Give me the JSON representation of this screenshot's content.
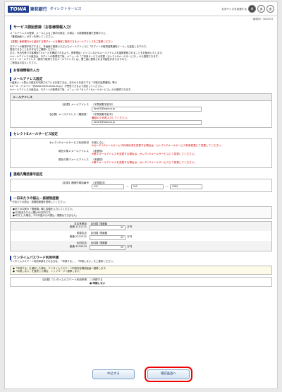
{
  "header": {
    "logo": "TOWA",
    "bank": "東和銀行",
    "service": "ダイレクトサービス",
    "font_size_label": "文字サイズを変更する",
    "font_sizes": [
      "標",
      "あ",
      "あ"
    ]
  },
  "screen_id": "画面ID：BL0003",
  "page_title": "サービス開始登録（お客様情報入力）",
  "intro": [
    "メールアドレスの登録、メールによるご案内の設定、お振込・お振替限度額を登録のうえ、",
    "「確認画面へ」ボタンを押してください。"
  ],
  "notice_red": "【重要】東和銀行から送信する電子メールを確実に受信できるメールアドレスをご登録ください",
  "notes": [
    "ログインの取得が完了すると、本画面で登録いただいたメールアドレスに「ログインの取得結果通知メール」を送信しますので、",
    "受信できることをお手元でご確認ください。",
    "また、外出先等でお客様宛てEメールを確認できるよう、携帯電話・パソコンなどのメールアドレスを複数登録されることをお勧めいたします。",
    "※メールアドレスの追加は、ログインの取得完了後、メニューの「ご利用サービスの変更（セレクトEメールサービス）」から登録できます。",
    "※フリーメールアドレス（無料で取得できるメールアドレス）は、第三者に悪用される可能性がありますので、",
    "ご使用はお控えください。"
  ],
  "customer_info_title": "お客様情報の入力",
  "email_section": {
    "title": "メールアドレス設定",
    "notes": [
      "※迷惑メール防止の設定を利用されているお客さまは、当行からお送りする「お取引結果通知」等の",
      "Eメール（ドメイン「@webcenter.anser.or.jp」）が受信できるよう設定してください。",
      "※メールアドレスの追加は、ログインの取得完了後、メニューの「セレクトEメールサービス」から登録できます。"
    ],
    "box_title": "メールアドレス",
    "email_label": "メールアドレス",
    "required": "【必須】",
    "email_hint": "（半角英数字記号）",
    "email_value": "taro01@towa.co.jp",
    "confirm_label": "メールアドレス（確認用）",
    "confirm_hint": "（半角英数字記号）",
    "confirm_note": "確認のため再入力してください。",
    "confirm_value": "taro01@towa.co.jp"
  },
  "select_section": {
    "title": "セレクトEメールサービス設定",
    "rows": [
      {
        "label": "セレクトEメールサービス利用状況",
        "value": "利用しない",
        "note": "※セレクトEメールサービス利用状況を変更する場合は、セレクトEメールサービス利用変更にて変更してください。"
      },
      {
        "label": "現在の第２メールアドレス",
        "value": "（未登録）",
        "note": "※第２メールアドレスを変更する場合は、セレクトEメールサービスにて変更してください。"
      },
      {
        "label": "現在の第３メールアドレス",
        "value": "（未登録）",
        "note": "※第３メールアドレスを変更する場合は、セレクトEメールサービスにて変更してください。"
      }
    ]
  },
  "phone_section": {
    "title": "連絡先電話番号設定",
    "required": "【必須】",
    "label": "連絡先電話番号",
    "hint": "（半角数字）",
    "values": [
      "012",
      "345",
      "6789"
    ]
  },
  "limit_section": {
    "title": "一日あたりの振込・振替限度額",
    "desc": "一日あたりの振込・振替限度額を登録してください。",
    "notes": [
      "●全ての口座の「限度額」欄に金額を入力してください。",
      "●1口座あたりの上限は50万円です。",
      "●0円とした場合、その口座からの振込・振替はできません。"
    ],
    "required": "【必須】",
    "limit_label": "限度額",
    "unit": "万円",
    "accounts": [
      {
        "branch": "本店営業部",
        "type": "普通",
        "number": "1111111",
        "limit": "50"
      },
      {
        "branch": "前橋支店",
        "type": "普通",
        "number": "2222222",
        "limit": "50"
      },
      {
        "branch": "太田支店",
        "type": "普通",
        "number": "3333333",
        "limit": "50"
      }
    ]
  },
  "otp_section": {
    "title": "ワンタイムパスワード利用申請",
    "desc": "ワンタイムパスワード利用申請をされる方は、「申請する」、「申請しない」をご選択ください。",
    "notes": [
      "●「申請する」を選択した場合、ワンタイムパスワード申請内容確認画面へ遷移します。",
      "●「申請しない」を選択した場合、トップページへ遷移します。"
    ],
    "required": "【必須】",
    "label": "ワンタイムパスワード利用申請",
    "option_yes": "申請する",
    "option_no": "申請しない"
  },
  "buttons": {
    "cancel": "中止する",
    "confirm": "確認画面へ"
  }
}
